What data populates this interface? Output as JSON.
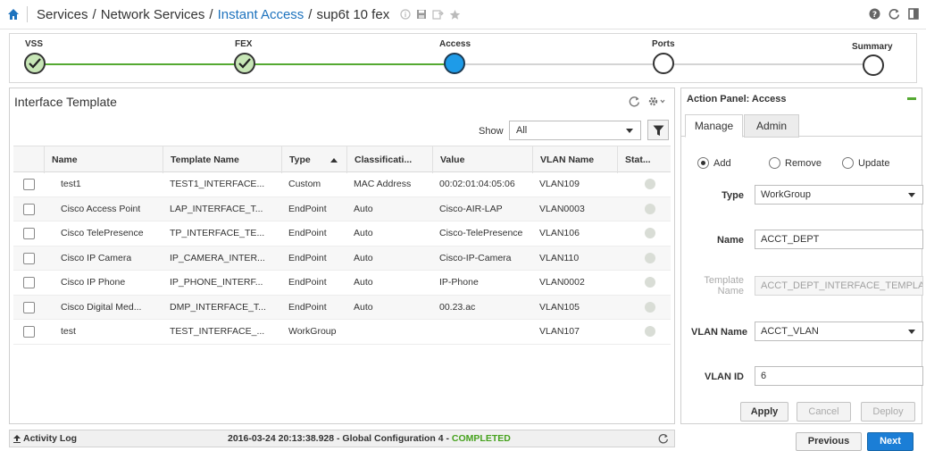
{
  "header": {
    "breadcrumb": [
      {
        "label": "Services",
        "link": false
      },
      {
        "label": "Network Services",
        "link": false
      },
      {
        "label": "Instant Access",
        "link": true
      },
      {
        "label": "sup6t 10 fex",
        "link": false
      }
    ],
    "separator": "/",
    "tool_icons": [
      "info-icon",
      "save-icon",
      "export-icon",
      "star-icon"
    ],
    "right_icons": [
      "help-icon",
      "refresh-icon",
      "panel-icon"
    ]
  },
  "wizard": {
    "steps": [
      {
        "label": "VSS",
        "state": "done"
      },
      {
        "label": "FEX",
        "state": "done"
      },
      {
        "label": "Access",
        "state": "active"
      },
      {
        "label": "Ports",
        "state": "pending"
      },
      {
        "label": "Summary",
        "state": "pending"
      }
    ]
  },
  "table_panel": {
    "title": "Interface Template",
    "show_label": "Show",
    "show_value": "All",
    "columns": [
      "Name",
      "Template Name",
      "Type",
      "Classificati...",
      "Value",
      "VLAN Name",
      "Stat..."
    ],
    "rows": [
      {
        "name": "test1",
        "template": "TEST1_INTERFACE...",
        "type": "Custom",
        "classification": "MAC Address",
        "value": "00:02:01:04:05:06",
        "vlan": "VLAN109"
      },
      {
        "name": "Cisco Access Point",
        "template": "LAP_INTERFACE_T...",
        "type": "EndPoint",
        "classification": "Auto",
        "value": "Cisco-AIR-LAP",
        "vlan": "VLAN0003"
      },
      {
        "name": "Cisco TelePresence",
        "template": "TP_INTERFACE_TE...",
        "type": "EndPoint",
        "classification": "Auto",
        "value": "Cisco-TelePresence",
        "vlan": "VLAN106"
      },
      {
        "name": "Cisco IP Camera",
        "template": "IP_CAMERA_INTER...",
        "type": "EndPoint",
        "classification": "Auto",
        "value": "Cisco-IP-Camera",
        "vlan": "VLAN110"
      },
      {
        "name": "Cisco IP Phone",
        "template": "IP_PHONE_INTERF...",
        "type": "EndPoint",
        "classification": "Auto",
        "value": "IP-Phone",
        "vlan": "VLAN0002"
      },
      {
        "name": "Cisco Digital Med...",
        "template": "DMP_INTERFACE_T...",
        "type": "EndPoint",
        "classification": "Auto",
        "value": "00.23.ac",
        "vlan": "VLAN105"
      },
      {
        "name": "test",
        "template": "TEST_INTERFACE_...",
        "type": "WorkGroup",
        "classification": "",
        "value": "",
        "vlan": "VLAN107"
      }
    ]
  },
  "statusbar": {
    "activity_label": "Activity Log",
    "message": "2016-03-24 20:13:38.928 - Global Configuration 4 - ",
    "status": "COMPLETED"
  },
  "action_panel": {
    "title": "Action Panel: Access",
    "tabs": [
      "Manage",
      "Admin"
    ],
    "radios": [
      {
        "label": "Add",
        "selected": true
      },
      {
        "label": "Remove",
        "selected": false
      },
      {
        "label": "Update",
        "selected": false
      }
    ],
    "type_label": "Type",
    "type_value": "WorkGroup",
    "name_label": "Name",
    "name_value": "ACCT_DEPT",
    "template_label_1": "Template",
    "template_label_2": "Name",
    "template_value": "ACCT_DEPT_INTERFACE_TEMPLA",
    "vlan_name_label": "VLAN Name",
    "vlan_name_value": "ACCT_VLAN",
    "vlan_id_label": "VLAN ID",
    "vlan_id_value": "6",
    "buttons": {
      "apply": "Apply",
      "cancel": "Cancel",
      "deploy": "Deploy"
    }
  },
  "navigation": {
    "previous": "Previous",
    "next": "Next"
  },
  "colors": {
    "accent": "#1e73be",
    "success": "#46a21e",
    "active_step": "#1e9be8",
    "next_button": "#1b7ed6"
  }
}
